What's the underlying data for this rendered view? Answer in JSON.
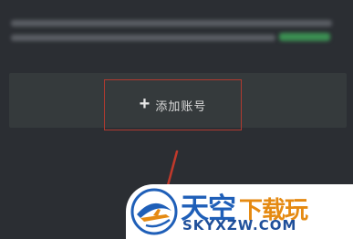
{
  "account_panel": {
    "add_account_label": "添加账号"
  },
  "watermark": {
    "brand_part1": "天空",
    "brand_part2": "下载玩",
    "url": "SKYXZW.COM"
  },
  "colors": {
    "background": "#2b2e33",
    "panel": "#353a3c",
    "highlight_border": "#b03a30",
    "link_green": "#3b8f52",
    "brand_blue": "#1f5fb8",
    "brand_orange": "#e58a12"
  },
  "icons": {
    "add": "plus-icon",
    "logo": "airplane-logo-icon"
  }
}
